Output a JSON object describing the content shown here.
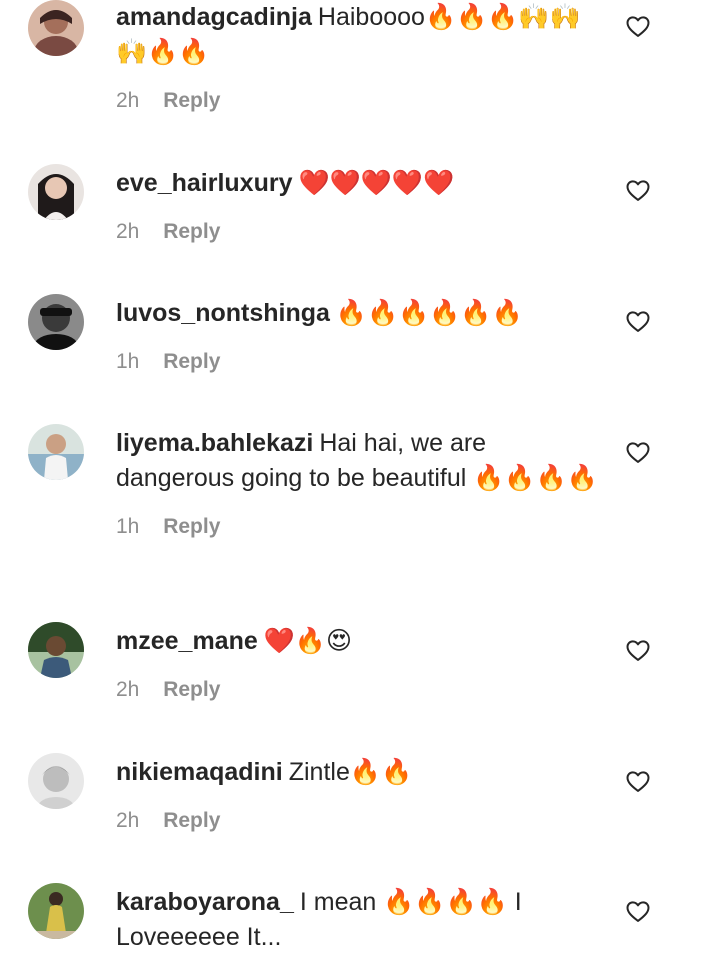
{
  "comments": [
    {
      "username": "amandagcadinja",
      "text": "Haiboooo🔥🔥🔥🙌🙌🙌🔥🔥",
      "time": "2h",
      "reply_label": "Reply",
      "avatar_colors": [
        "#7a4a42",
        "#d8b6a4",
        "#3b2421"
      ]
    },
    {
      "username": "eve_hairluxury",
      "text": "❤️❤️❤️❤️❤️",
      "time": "2h",
      "reply_label": "Reply",
      "avatar_colors": [
        "#1f1a1a",
        "#e7c7b4",
        "#e9e4e1"
      ]
    },
    {
      "username": "luvos_nontshinga",
      "text": "🔥🔥🔥🔥🔥🔥",
      "time": "1h",
      "reply_label": "Reply",
      "avatar_colors": [
        "#3a3a3a",
        "#8a8a8a",
        "#111111"
      ]
    },
    {
      "username": "liyema.bahlekazi",
      "text": "Hai hai, we are dangerous going to be beautiful 🔥🔥🔥🔥",
      "time": "1h",
      "reply_label": "Reply",
      "avatar_colors": [
        "#8fb2c8",
        "#caa084",
        "#d9e3df"
      ]
    },
    {
      "username": "mzee_mane",
      "text": "❤️🔥😍",
      "time": "2h",
      "reply_label": "Reply",
      "avatar_colors": [
        "#2f4b2a",
        "#6a4a33",
        "#a8c2a0"
      ]
    },
    {
      "username": "nikiemaqadini",
      "text": "Zintle🔥🔥",
      "time": "2h",
      "reply_label": "Reply",
      "avatar_colors": [
        "#e8e8e8",
        "#6a6a6a",
        "#bdbdbd"
      ]
    },
    {
      "username": "karaboyarona_",
      "text": "I mean 🔥🔥🔥🔥 I Loveeeeee It...",
      "time": "",
      "reply_label": "",
      "avatar_colors": [
        "#d9c04a",
        "#6d8f4d",
        "#3a2a22"
      ]
    }
  ]
}
